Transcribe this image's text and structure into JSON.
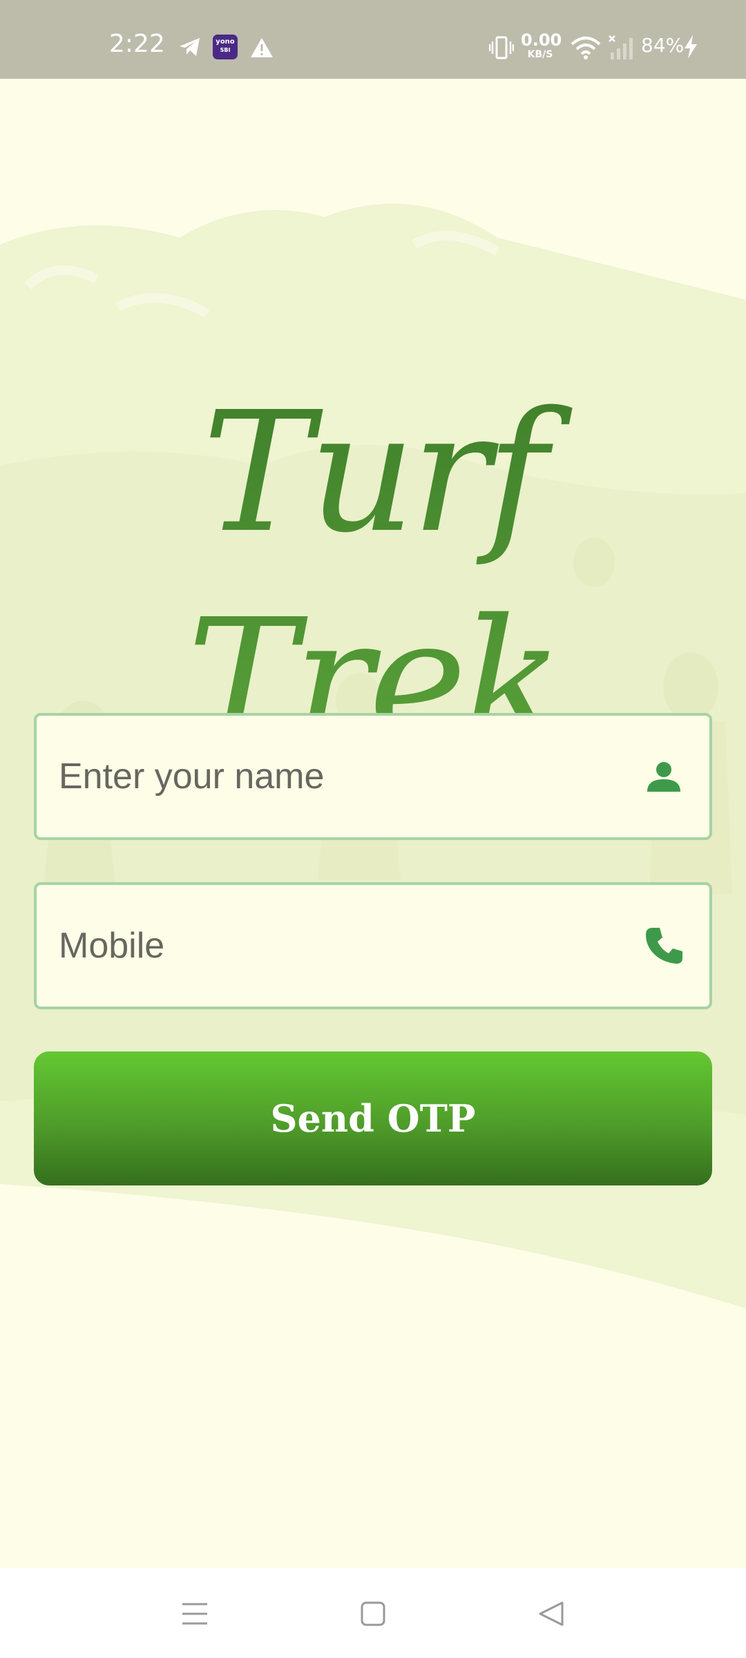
{
  "status_bar": {
    "time": "2:22",
    "notification_icons": [
      "telegram-icon",
      "yono-sbi-icon",
      "warning-icon"
    ],
    "yono_label_top": "yono",
    "yono_label_bottom": "SBI",
    "net_speed_value": "0.00",
    "net_speed_unit": "KB/S",
    "battery_percent": "84%",
    "system_icons": [
      "vibrate-icon",
      "wifi-icon",
      "signal-icon",
      "battery-charging-icon"
    ]
  },
  "app": {
    "logo_text": "Turf Trek",
    "brand_color": "#4b8f2e",
    "name_field": {
      "placeholder": "Enter your name",
      "value": "",
      "icon": "person-icon"
    },
    "mobile_field": {
      "placeholder": "Mobile",
      "value": "",
      "icon": "phone-icon"
    },
    "send_button_label": "Send OTP"
  },
  "nav_bar": {
    "icons": [
      "menu-icon",
      "home-square-icon",
      "back-triangle-icon"
    ]
  }
}
